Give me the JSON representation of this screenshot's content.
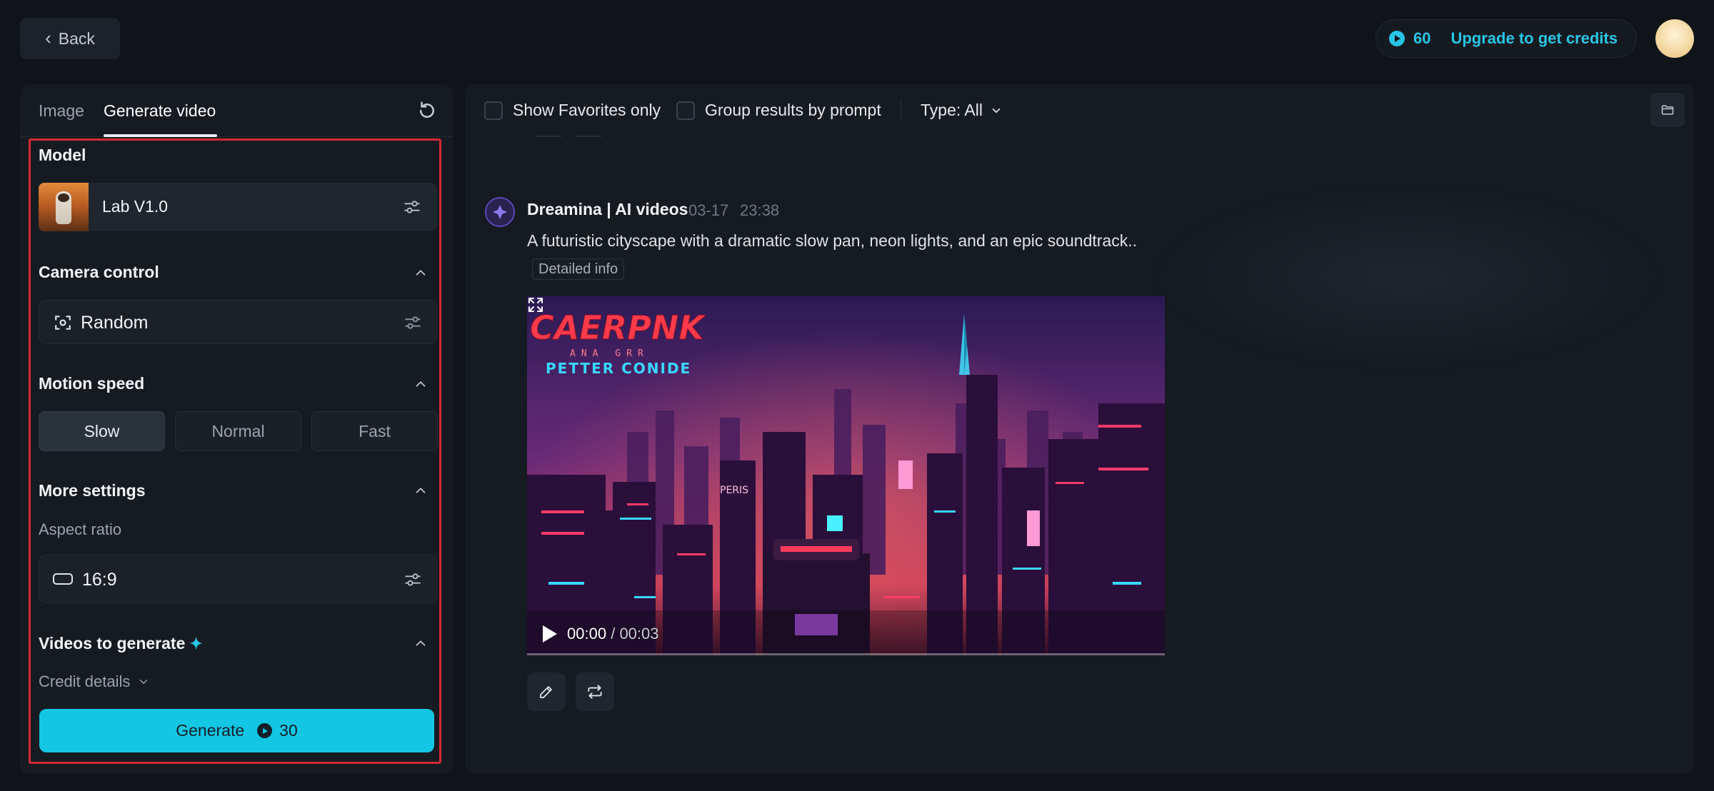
{
  "topbar": {
    "back_label": "Back",
    "credits": "60",
    "upgrade_label": "Upgrade to get credits"
  },
  "left": {
    "tabs": [
      {
        "label": "Image",
        "active": false
      },
      {
        "label": "Generate video",
        "active": true
      }
    ],
    "model": {
      "title": "Model",
      "name": "Lab V1.0"
    },
    "camera": {
      "title": "Camera control",
      "value": "Random"
    },
    "motion": {
      "title": "Motion speed",
      "options": [
        "Slow",
        "Normal",
        "Fast"
      ],
      "selected": "Slow"
    },
    "more": {
      "title": "More settings",
      "aspect_label": "Aspect ratio",
      "aspect_value": "16:9"
    },
    "videos": {
      "title": "Videos to generate",
      "credit_details": "Credit details"
    },
    "generate": {
      "label": "Generate",
      "cost": "30"
    }
  },
  "right": {
    "filters": {
      "favorites": "Show Favorites only",
      "group": "Group results by prompt",
      "type": "Type: All"
    },
    "post": {
      "author": "Dreamina | AI videos",
      "date": "03-17",
      "time": "23:38",
      "prompt": "A futuristic cityscape with a dramatic slow pan, neon lights, and an epic soundtrack..",
      "detail_chip": "Detailed info",
      "video": {
        "title_line1": "CAERPNK",
        "title_line2": "ANA GRR",
        "title_line3": "PETTER CONIDE",
        "sign_text": "PERIS",
        "current_time": "00:00",
        "separator": "/",
        "duration": "00:03"
      }
    }
  },
  "colors": {
    "accent": "#12c6e4",
    "highlight_box": "#d42a34",
    "panel": "#161b21",
    "background": "#101419"
  },
  "icons": {
    "back": "chevron-left-icon",
    "credit": "credit-play-icon",
    "reset": "reset-icon",
    "settings": "sliders-icon",
    "camera": "camera-focus-icon",
    "collapse": "chevron-up-icon",
    "aspect": "aspect-rect-icon",
    "sparkle": "sparkle-icon",
    "folder": "folder-icon",
    "edit": "pencil-icon",
    "regenerate": "repeat-icon",
    "fullscreen": "fullscreen-icon"
  }
}
